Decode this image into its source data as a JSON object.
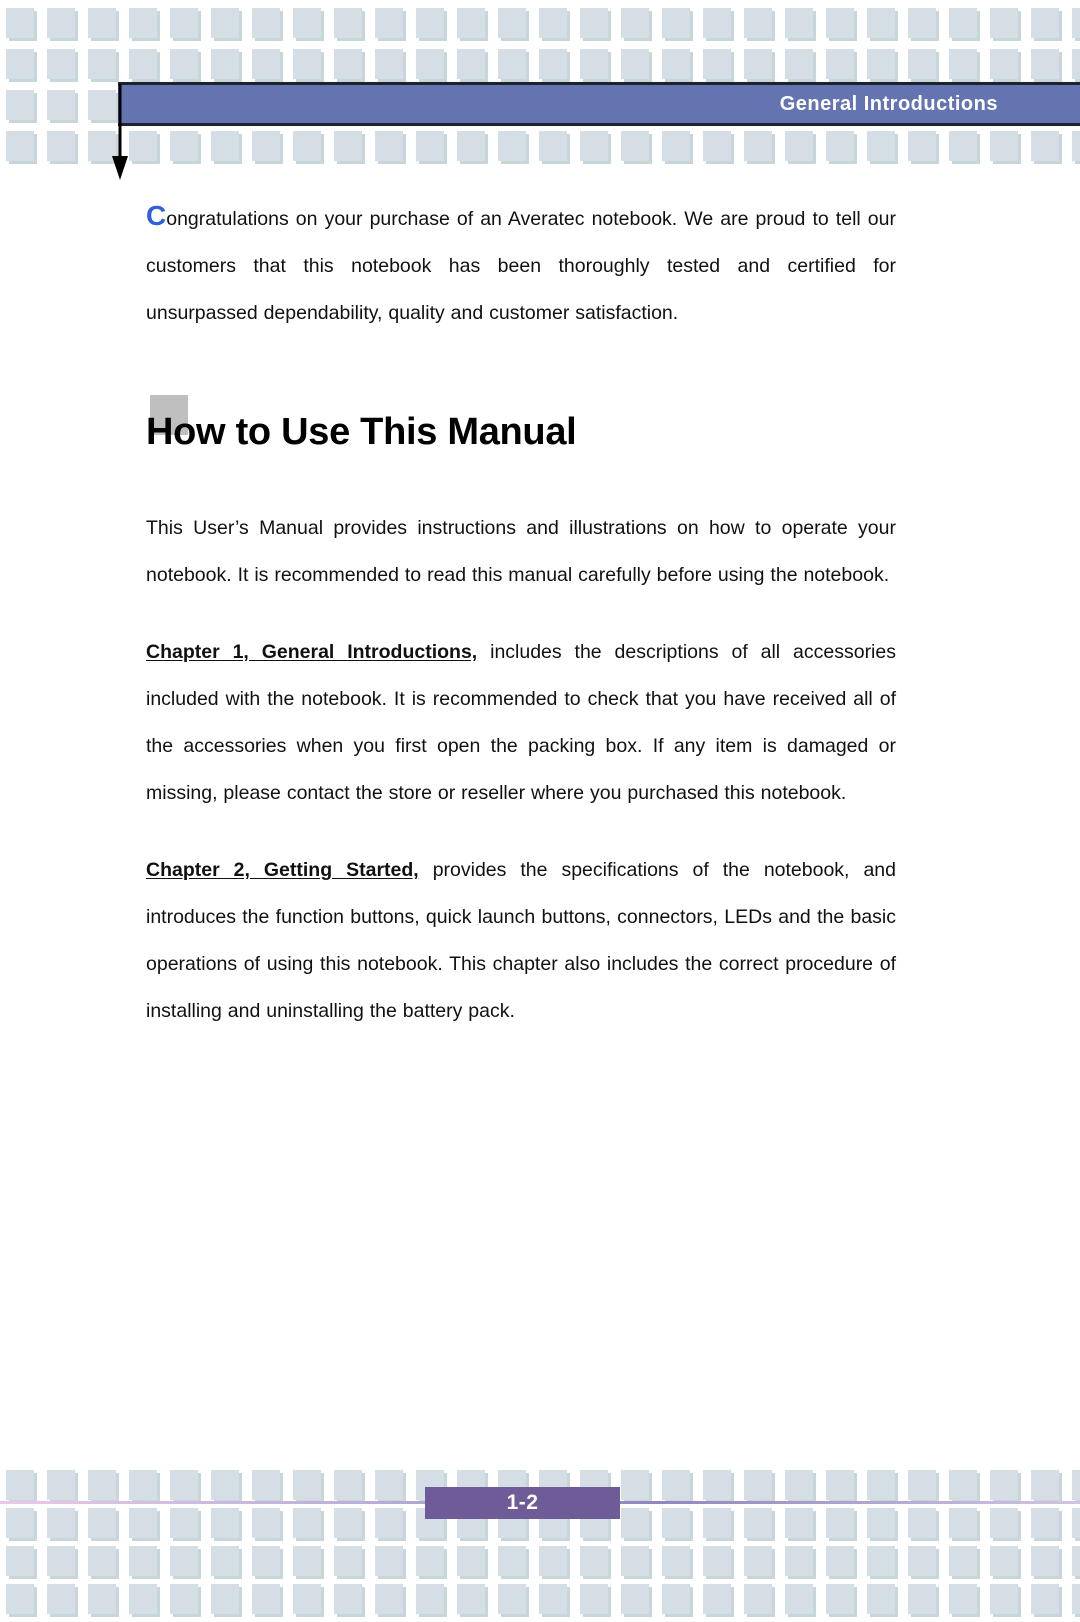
{
  "document": {
    "header": {
      "title": "General Introductions"
    },
    "footer": {
      "page_number": "1-2"
    },
    "intro": {
      "dropcap": "C",
      "text": "ongratulations on your purchase of an Averatec notebook.   We are proud to tell our customers that this notebook has been thoroughly tested and certified for unsurpassed dependability, quality and customer satisfaction."
    },
    "section": {
      "heading": "How to Use This Manual",
      "paragraphs": [
        {
          "lead": "",
          "text": "This User’s Manual provides instructions and illustrations on how to operate your notebook.   It is recommended to read this manual carefully before using the notebook."
        },
        {
          "lead": "Chapter 1, General Introductions,",
          "text": " includes the descriptions of all accessories included with the notebook.   It is recommended to check that you have received all of the accessories when you first open the packing box.   If any item is damaged or missing, please contact the store or reseller where you purchased this notebook."
        },
        {
          "lead": "Chapter 2, Getting Started,",
          "text": " provides the specifications of the notebook, and introduces the function buttons, quick launch buttons, connectors, LEDs and the basic operations of using this notebook.   This chapter also includes the correct procedure of installing and uninstalling the battery pack."
        }
      ]
    },
    "colors": {
      "header_bar": "#6374b0",
      "header_text": "#ffffff",
      "dropcap": "#2f5fe0",
      "heading_swatch": "#bfbfbf",
      "page_number_box": "#6f5b97",
      "decorative_square": "#d6dee5",
      "footer_rule": "#8f86bd"
    }
  }
}
